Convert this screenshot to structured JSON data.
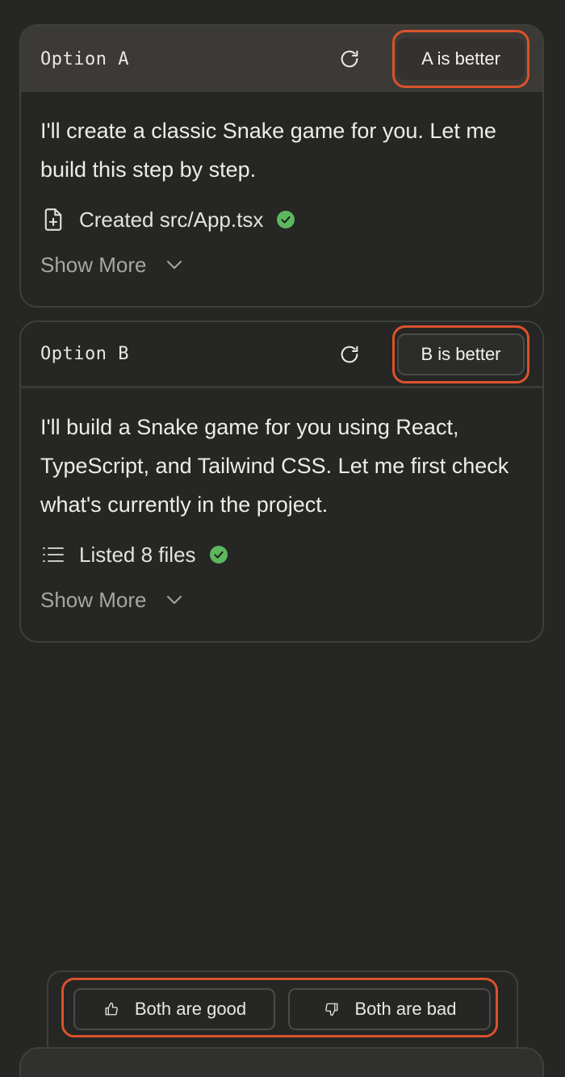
{
  "options": [
    {
      "title": "Option A",
      "better_label": "A is better",
      "message": "I'll create a classic Snake game for you. Let me build this step by step.",
      "tool_label": "Created src/App.tsx",
      "tool_icon": "file-plus-icon",
      "show_more_label": "Show More"
    },
    {
      "title": "Option B",
      "better_label": "B is better",
      "message": "I'll build a Snake game for you using React, TypeScript, and Tailwind CSS. Let me first check what's currently in the project.",
      "tool_label": "Listed 8 files",
      "tool_icon": "list-icon",
      "show_more_label": "Show More"
    }
  ],
  "vote": {
    "good_label": "Both are good",
    "bad_label": "Both are bad"
  },
  "colors": {
    "highlight": "#d9532c",
    "success": "#5cb85c",
    "background": "#262624"
  }
}
